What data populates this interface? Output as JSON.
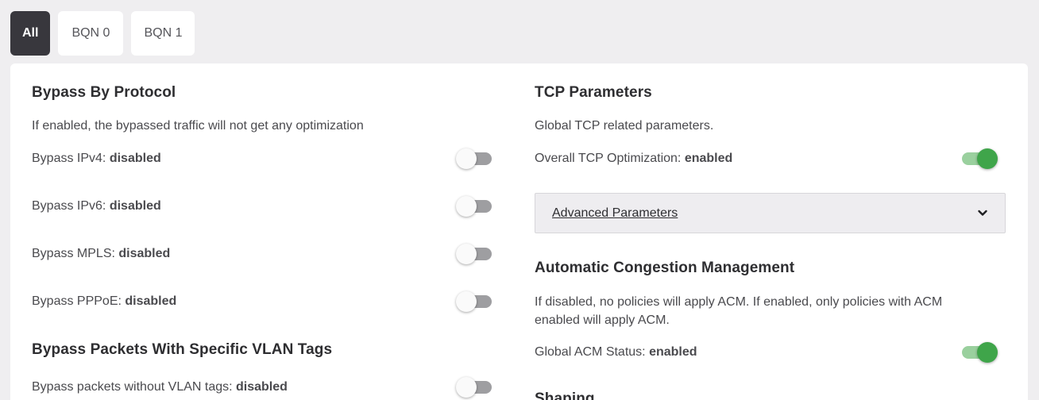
{
  "tabs": [
    {
      "label": "All",
      "active": true
    },
    {
      "label": "BQN 0",
      "active": false
    },
    {
      "label": "BQN 1",
      "active": false
    }
  ],
  "left": {
    "protocol": {
      "title": "Bypass By Protocol",
      "description": "If enabled, the bypassed traffic will not get any optimization",
      "rows": [
        {
          "label": "Bypass IPv4: ",
          "status": "disabled",
          "on": false
        },
        {
          "label": "Bypass IPv6: ",
          "status": "disabled",
          "on": false
        },
        {
          "label": "Bypass MPLS: ",
          "status": "disabled",
          "on": false
        },
        {
          "label": "Bypass PPPoE: ",
          "status": "disabled",
          "on": false
        }
      ]
    },
    "vlan": {
      "title": "Bypass Packets With Specific VLAN Tags",
      "rows": [
        {
          "label": "Bypass packets without VLAN tags: ",
          "status": "disabled",
          "on": false
        }
      ]
    }
  },
  "right": {
    "tcp": {
      "title": "TCP Parameters",
      "description": "Global TCP related parameters.",
      "row": {
        "label": "Overall TCP Optimization: ",
        "status": "enabled",
        "on": true
      },
      "advanced_label": "Advanced Parameters"
    },
    "acm": {
      "title": "Automatic Congestion Management",
      "description_line1": "If disabled, no policies will apply ACM. If enabled, only policies with ACM",
      "description_line2": "enabled will apply ACM.",
      "row": {
        "label": "Global ACM Status: ",
        "status": "enabled",
        "on": true
      }
    },
    "shaping": {
      "title": "Shaping"
    }
  },
  "colors": {
    "enabled_knob": "#3fa54a",
    "active_tab": "#38373d"
  },
  "icons": {
    "accordion": "chevron-down-icon"
  }
}
